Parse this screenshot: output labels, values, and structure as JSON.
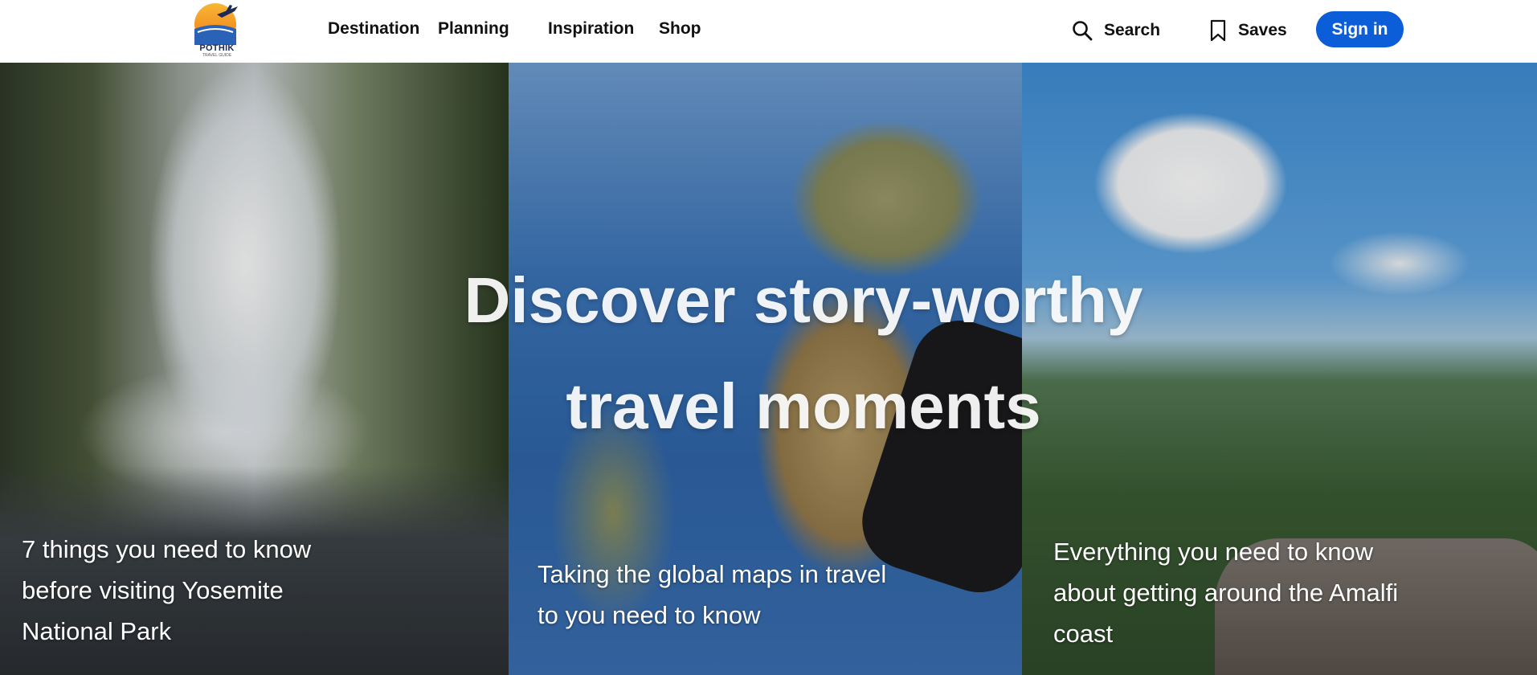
{
  "brand": {
    "name": "POTHIK",
    "tagline": "TRAVEL GUIDE"
  },
  "nav": {
    "items": [
      {
        "label": "Destination"
      },
      {
        "label": "Planning"
      },
      {
        "label": "Inspiration"
      },
      {
        "label": "Shop"
      }
    ]
  },
  "actions": {
    "search_label": "Search",
    "saves_label": "Saves",
    "signin_label": "Sign in"
  },
  "hero": {
    "title_line1": "Discover story-worthy",
    "title_line2": "travel moments",
    "panels": [
      {
        "caption": "7 things you need to know before visiting Yosemite National Park"
      },
      {
        "caption": "Taking the global maps in travel to you need to know"
      },
      {
        "caption": "Everything you need to know about getting around the Amalfi coast"
      }
    ]
  },
  "colors": {
    "accent": "#0b5ed7",
    "header_bg": "#ffffff",
    "text": "#111111"
  }
}
